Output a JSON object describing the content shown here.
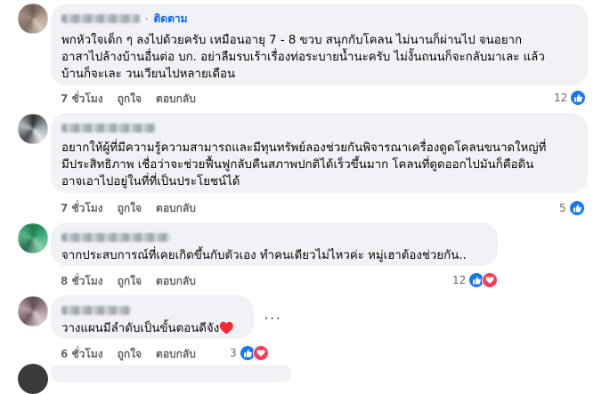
{
  "comments": [
    {
      "follow_label": "ติดตาม",
      "dot": "·",
      "text": "พกหัวใจเด็ก ๆ ลงไปด้วยครับ เหมือนอายุ 7 - 8 ขวบ สนุกกับโคลน ไม่นานก็ผ่านไป จนอยาก\nอาสาไปล้างบ้านอื่นต่อ บก. อย่าลืมรบเร้าเรื่องท่อระบายน้ำนะครับ ไม่งั้นถนนก็จะกลับมาเละ แล้ว\nบ้านก็จะเละ วนเวียนไปหลายเดือน",
      "time": "7 ชั่วโมง",
      "like": "ถูกใจ",
      "reply": "ตอบกลับ",
      "reaction_count": "12"
    },
    {
      "text": "อยากให้ผู้ที่มีความรู้ความสามารถและมีทุนทรัพย์ลองช่วยกันพิจารณาเครื่องดูดโคลนขนาดใหญ่ที่\nมีประสิทธิภาพ เชื่อว่าจะช่วยฟื้นฟูกลับคืนสภาพปกติได้เร็วขึ้นมาก โคลนที่ดูดออกไปมันก็คือดิน\nอาจเอาไปอยู่ในที่ที่เป็นประโยชน์ได้",
      "time": "7 ชั่วโมง",
      "like": "ถูกใจ",
      "reply": "ตอบกลับ",
      "reaction_count": "5"
    },
    {
      "text": "จากประสบการณ์ที่เคยเกิดขึ้นกับตัวเอง ทำคนเดียวไม่ไหวค่ะ หมู่เฮาต้องช่วยกัน..",
      "time": "8 ชั่วโมง",
      "like": "ถูกใจ",
      "reply": "ตอบกลับ",
      "reaction_count": "12"
    },
    {
      "text": "วางแผนมีลำดับเป็นขั้นตอนดีจัง♥️",
      "time": "6 ชั่วโมง",
      "like": "ถูกใจ",
      "reply": "ตอบกลับ",
      "reaction_count": "3",
      "more_label": "···"
    }
  ],
  "colors": {
    "like": "#1877f2",
    "love": "#f33e58",
    "bubble": "#f0f2f5",
    "link": "#0866ff"
  },
  "icons": [
    "like-icon",
    "love-icon",
    "more-options-icon"
  ]
}
